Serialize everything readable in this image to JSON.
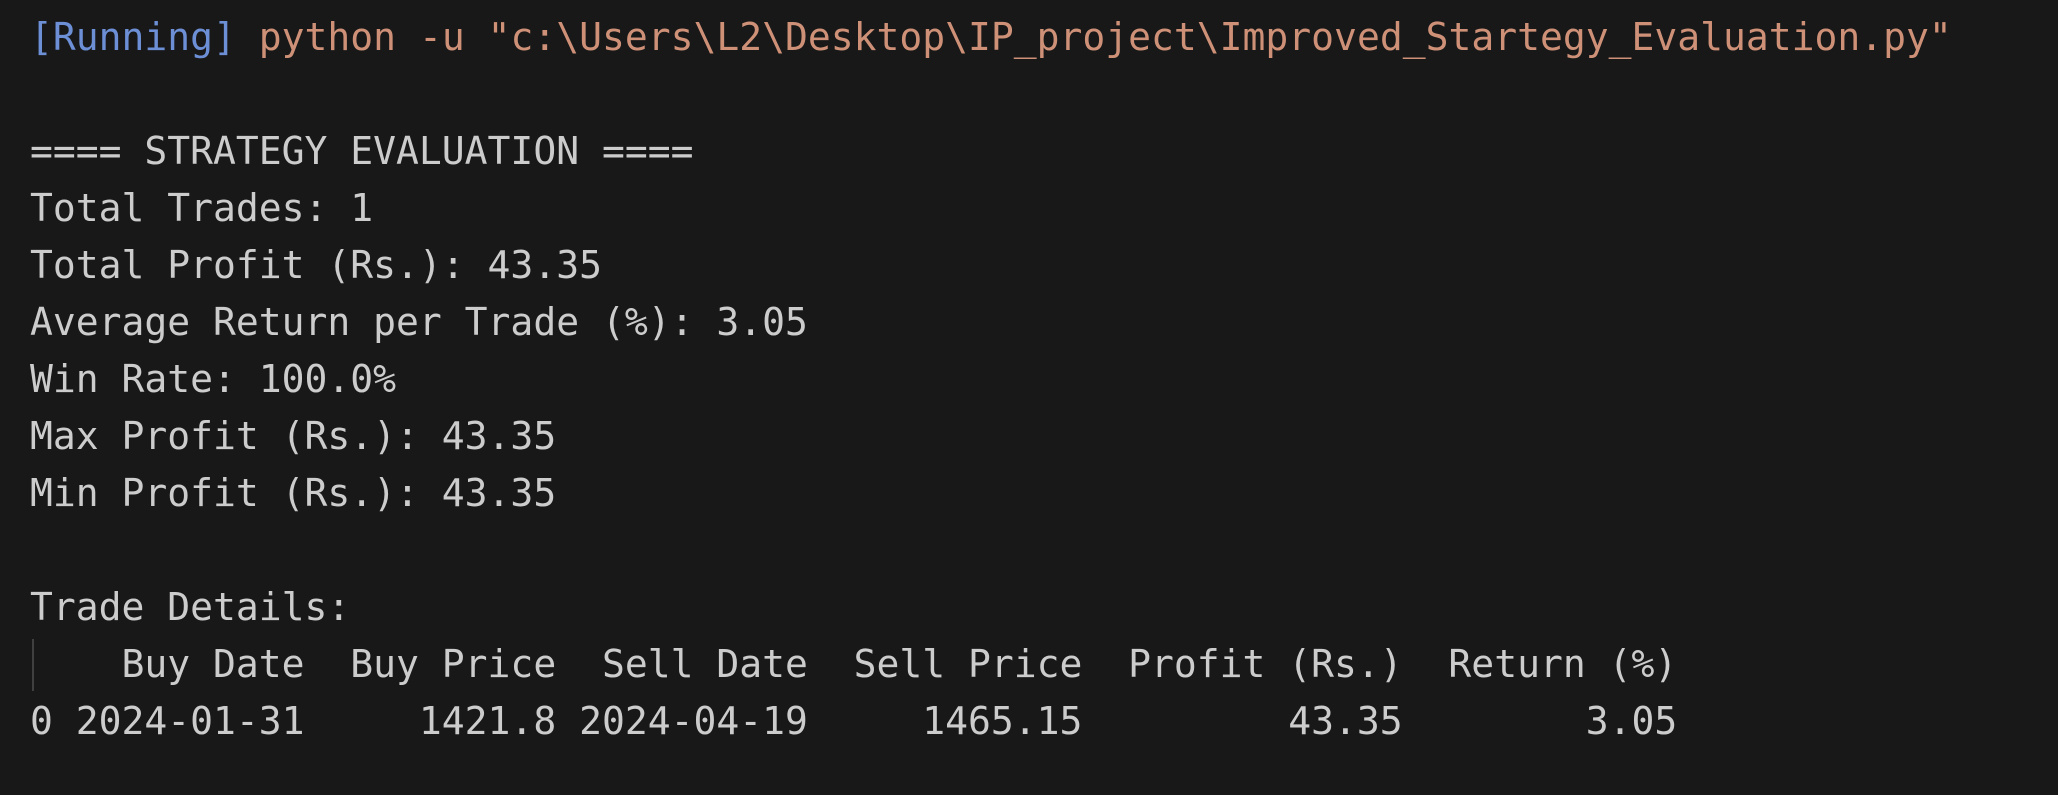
{
  "terminal": {
    "run_tag": "[Running]",
    "command": "python -u \"c:\\Users\\L2\\Desktop\\IP_project\\Improved_Startegy_Evaluation.py\""
  },
  "output": {
    "heading": "==== STRATEGY EVALUATION ====",
    "total_trades": "Total Trades: 1",
    "total_profit": "Total Profit (Rs.): 43.35",
    "avg_return": "Average Return per Trade (%): 3.05",
    "win_rate": "Win Rate: 100.0%",
    "max_profit": "Max Profit (Rs.): 43.35",
    "min_profit": "Min Profit (Rs.): 43.35",
    "trade_details_label": "Trade Details:",
    "table_header": "    Buy Date  Buy Price  Sell Date  Sell Price  Profit (Rs.)  Return (%)",
    "table_row_0": "0 2024-01-31     1421.8 2024-04-19     1465.15         43.35        3.05"
  }
}
